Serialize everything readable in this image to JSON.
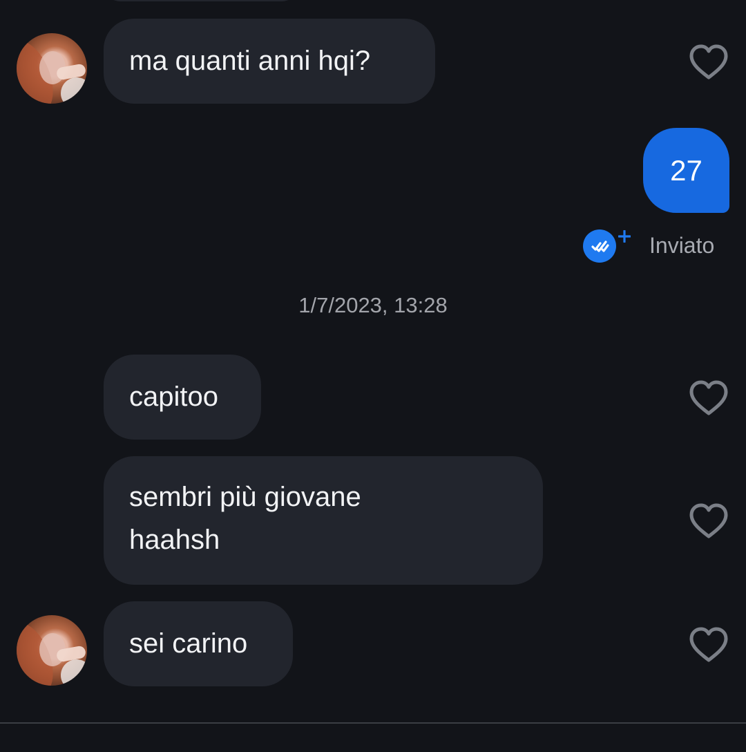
{
  "conversation": {
    "messages": [
      {
        "text": "ma quanti anni hqi?"
      },
      {
        "text": "27"
      },
      {
        "text": "capitoo"
      },
      {
        "text_line1": "sembri più giovane",
        "text_line2": "haahsh"
      },
      {
        "text": "sei carino"
      }
    ],
    "sent_status": "Inviato",
    "timestamp": "1/7/2023, 13:28"
  },
  "icons": {
    "like": "heart-outline-icon",
    "read_receipt": "double-check-icon",
    "add": "plus-icon"
  },
  "colors": {
    "background": "#121419",
    "received_bubble": "#22252d",
    "sent_bubble": "#1769e0",
    "status_icon": "#1f7af0",
    "muted_text": "#a8abb2"
  }
}
